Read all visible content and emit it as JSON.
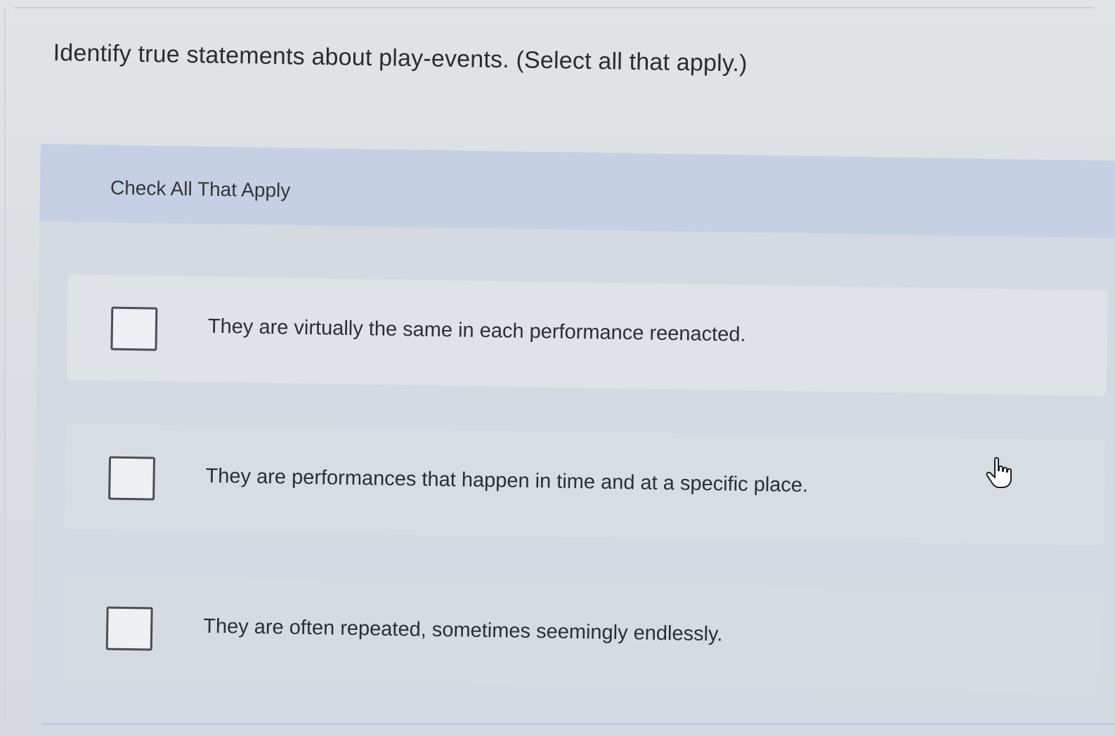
{
  "question": {
    "text": "Identify true statements about play-events. (Select all that apply.)"
  },
  "panel": {
    "header": "Check All That Apply",
    "options": [
      {
        "label": "They are virtually the same in each performance reenacted.",
        "checked": false
      },
      {
        "label": "They are performances that happen in time and at a specific place.",
        "checked": false
      },
      {
        "label": "They are often repeated, sometimes seemingly endlessly.",
        "checked": false
      }
    ]
  },
  "cursor": {
    "icon": "hand-pointer-icon"
  },
  "colors": {
    "background": "#dcdee2",
    "header_band": "#c5d0e4",
    "text": "#2c2e31"
  }
}
